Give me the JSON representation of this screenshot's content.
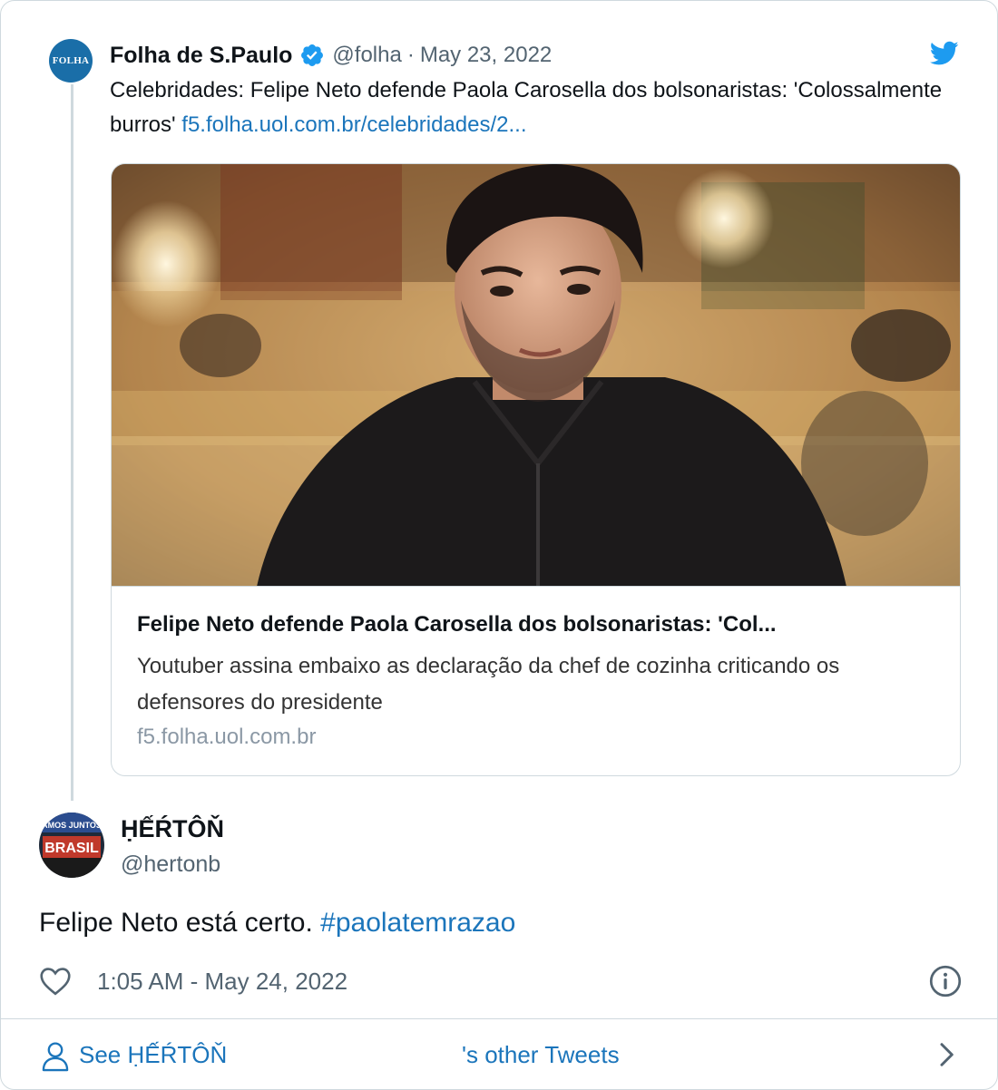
{
  "parent_tweet": {
    "avatar_text": "FOLHA",
    "name": "Folha de S.Paulo",
    "handle": "@folha",
    "separator": "·",
    "date": "May 23, 2022",
    "text": "Celebridades: Felipe Neto defende Paola Carosella dos bolsonaristas: 'Colossalmente burros' ",
    "link": "f5.folha.uol.com.br/celebridades/2...",
    "card": {
      "title": "Felipe Neto defende Paola Carosella dos bolsonaristas: 'Col...",
      "description": "Youtuber assina embaixo as declaração da chef de cozinha criticando os defensores do presidente",
      "domain": "f5.folha.uol.com.br"
    }
  },
  "reply_tweet": {
    "avatar_text": "BRASIL",
    "avatar_small_text": "AMOS JUNTOS",
    "name": "ḤẾŔTÔŇ",
    "handle": "@hertonb",
    "text": "Felipe Neto está certo. ",
    "hashtag": "#paolatemrazao",
    "timestamp": "1:05 AM - May 24, 2022"
  },
  "footer": {
    "see_label": "See ḤẾŔTÔŇ",
    "other_label": "'s other Tweets"
  },
  "icons": {
    "verified": "verified-badge-icon",
    "bird": "twitter-bird-icon",
    "heart": "heart-icon",
    "info": "info-icon",
    "person": "person-icon",
    "chevron": "chevron-right-icon"
  },
  "colors": {
    "twitter_blue": "#1d9bf0",
    "link_blue": "#1b75bb",
    "secondary_text": "#536471",
    "border": "#cfd9de",
    "folha_blue": "#1a6ea8"
  }
}
